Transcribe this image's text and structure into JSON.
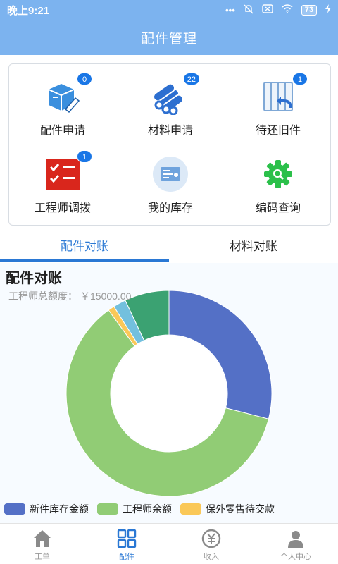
{
  "status": {
    "time": "晚上9:21",
    "battery": "73"
  },
  "header": {
    "title": "配件管理"
  },
  "grid": [
    {
      "label": "配件申请",
      "badge": "0",
      "icon": "box-pencil-icon"
    },
    {
      "label": "材料申请",
      "badge": "22",
      "icon": "pipes-icon"
    },
    {
      "label": "待还旧件",
      "badge": "1",
      "icon": "return-parts-icon"
    },
    {
      "label": "工程师调拨",
      "badge": "1",
      "icon": "checklist-icon"
    },
    {
      "label": "我的库存",
      "badge": "",
      "icon": "inventory-card-icon"
    },
    {
      "label": "编码查询",
      "badge": "",
      "icon": "gear-search-icon"
    }
  ],
  "tabs": [
    {
      "label": "配件对账",
      "active": true
    },
    {
      "label": "材料对账",
      "active": false
    }
  ],
  "section": {
    "title": "配件对账",
    "quota_label": "工程师总额度：",
    "quota_value": "￥15000.00"
  },
  "chart_data": {
    "type": "pie",
    "title": "",
    "series": [
      {
        "name": "新件库存金额",
        "value": 29,
        "color": "#5470c6"
      },
      {
        "name": "工程师余额",
        "value": 61,
        "color": "#91cc75"
      },
      {
        "name": "保外零售待交款",
        "value": 1,
        "color": "#fac858"
      },
      {
        "name": "",
        "value": 2,
        "color": "#73c0de"
      },
      {
        "name": "",
        "value": 7,
        "color": "#3ba272"
      }
    ],
    "legend_position": "bottom"
  },
  "nav": [
    {
      "label": "工单",
      "icon": "home-icon",
      "active": false
    },
    {
      "label": "配件",
      "icon": "grid-icon",
      "active": true
    },
    {
      "label": "收入",
      "icon": "yuan-icon",
      "active": false
    },
    {
      "label": "个人中心",
      "icon": "person-icon",
      "active": false
    }
  ],
  "colors": {
    "header": "#7cb3ef",
    "accent": "#2a78d4",
    "badge": "#1976e6"
  }
}
